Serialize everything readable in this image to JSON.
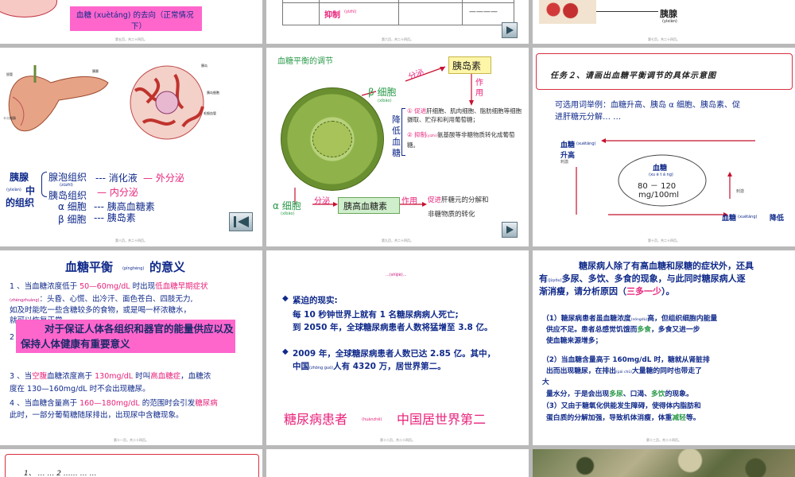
{
  "slides": {
    "s1": {
      "caption": "血糖 (xuètáng) 的去向（正常情况下）",
      "caption_l1": "血糖 (xuètáng) 的去向（正常情况",
      "caption_l2": "下）",
      "page": "第五页，共二十四页。"
    },
    "s2": {
      "row_label": "抑制",
      "row_pinyin": "(yìzhì)",
      "row_value": "————",
      "page": "第六页，共二十四页。"
    },
    "s3": {
      "label": "胰腺",
      "pinyin": "(yíxiàn)",
      "page": "第七页，共二十四页。"
    },
    "s4": {
      "title_main": "胰腺",
      "title_pinyin": "(yíxiàn)",
      "title_rest": "中",
      "title_l2": "的组织",
      "exo": "腺泡组织",
      "exo_pinyin": "(zūzhī)",
      "endo": "胰岛组织",
      "line1_a": "--- 消化液",
      "line1_b": "— 外分泌",
      "line2": "— 内分泌",
      "alpha": "α 细胞",
      "alpha_v": "--- 胰高血糖素",
      "beta": "β 细胞",
      "beta_v": "--- 胰岛素",
      "fig_labels": [
        "胆管",
        "胰腺",
        "十二指肠",
        "胰岛",
        "胰岛细胞",
        "毛细血管"
      ],
      "page": "第八页，共二十四页。"
    },
    "s5": {
      "title": "血糖平衡的调节",
      "beta_cell": "β 细胞",
      "beta_pinyin": "(xìbāo)",
      "secrete": "分泌",
      "insulin": "胰岛素",
      "action": "作用",
      "side_label": "降低血糖",
      "p1_head": "① 促进",
      "p1": "肝细胞、肌肉细胞、脂肪细胞等细胞摄取、贮存和利用葡萄糖；",
      "p2_head": "② 抑制",
      "p2_pinyin": "(yìzhì)",
      "p2": "氨基酸等非糖物质转化成葡萄糖。",
      "alpha_cell": "α 细胞",
      "alpha_pinyin": "(xìbāo)",
      "secrete2": "分泌",
      "glucagon": "胰高血糖素",
      "action2": "作用",
      "promote2_head": "促进",
      "promote2": "肝糖元的分解和",
      "promote2_l2": "非糖物质的转化",
      "page": "第九页，共二十四页。"
    },
    "s6": {
      "title": "任务２、请画出血糖平衡调节的具体示意图",
      "words_l1": "可选用词举例：血糖升高、胰岛 α 细胞、胰岛素、促",
      "words_l2": "进肝糖元分解… …",
      "rise_a": "血糖",
      "rise_pinyin": "(xuètáng)",
      "rise_b": "升高",
      "stim": "刺激",
      "center": "血糖",
      "center_pinyin": "(xu è t á ng)",
      "range": "80 － 120",
      "unit": "mg/100ml",
      "stim2": "刺激",
      "fall_a": "血糖",
      "fall_pinyin": "(xuètáng)",
      "fall_b": "降低",
      "page": "第十页，共二十四页。"
    },
    "s7": {
      "title": "血糖平衡",
      "title_pinyin": "(pínghéng)",
      "title_end": "的意义",
      "l1a": "1 、当血糖浓度低于 ",
      "l1b": "50—60mg/dL",
      "l1c": " 时出现",
      "l1d": "低血糖早期症状",
      "l1_pinyin": "(zhèngzhuàng)",
      "l1e": "：头昏、心慌、出冷汗、面色苍白、四肢无力,",
      "l2": "如及时能吃一些含糖较多的食物，或是喝一杯浓糖水，",
      "l3": "就可以恢复正常",
      "box": "对于保证人体各组织和器官的能量供应以及保持人体健康有重要意义",
      "n2": "2",
      "l4a": "3 、当",
      "l4b": "空腹",
      "l4c": "血糖浓度高于 ",
      "l4d": "130mg/dL",
      "l4e": " 时叫",
      "l4f": "高血糖症",
      "l4g": "，血糖浓",
      "l5": "度在 130—160mg/dL 时不会出现糖尿。",
      "l6a": "4 、当血糖含量高于 ",
      "l6b": "160—180mg/dL",
      "l6c": " 的范围时会引发",
      "l6d": "糖尿病",
      "l7": "此时，一部分葡萄糖随尿排出，出现尿中含糖现象。",
      "page": "第十一页，共二十四页。"
    },
    "s8": {
      "header": "...(shìjiè)...",
      "b1_title": "紧迫的现实:",
      "b1_l1": "每 10 秒钟世界上就有 1 名糖尿病病人死亡;",
      "b1_l2": "到 2050 年，全球糖尿病患者人数将猛增至 3.8 亿。",
      "b2_l1": "2009 年，全球糖尿病患者人数已达 2.85 亿。其中，",
      "b2_l2a": "中国",
      "b2_pinyin": "(zhōng guó)",
      "b2_l2b": "人有 4320 万，居世界第二。",
      "footer_a": "糖尿病患者",
      "footer_pinyin": "(huànzhě)",
      "footer_b": "中国居世界第二",
      "page": "第十二页，共二十四页。"
    },
    "s9": {
      "p_l1": "糖尿病人除了有高血糖和尿糖的症状外，还具",
      "p_l2a": "有",
      "p_pinyin": "(jùyǒu)",
      "p_l2b": "多尿、多饮、多食的现象，与此同时糖尿病人逐",
      "p_l3a": "渐消瘦，请分析原因（",
      "p_l3b": "三多一少",
      "p_l3c": "）。",
      "a1_l1a": "（1）糖尿病患者虽血糖浓度",
      "a1_pinyin": "(nóngdù)",
      "a1_l1b": "高，但组织细胞内能量",
      "a1_l2a": "供应不足。患者总感觉饥饿而",
      "a1_l2b": "多食",
      "a1_l2c": "，多食又进一步",
      "a1_l3": "使血糖来源增多；",
      "a2_l1": "（2）当血糖含量高于 160mg/dL 时，糖就从肾脏排",
      "a2_l2a": "出而出现糖尿，在排出",
      "a2_pinyin": "(pái chū)",
      "a2_l2b": "大量糖的同时也带走了",
      "a2_l3": "大",
      "a2_l4a": "量水分，于是会出现",
      "a2_l4b": "多尿",
      "a2_l4c": "、口渴、",
      "a2_l4d": "多饮",
      "a2_l4e": "的现象。",
      "a3_l1": "（3）又由于糖氧化供能发生障碍，使得体内脂肪和",
      "a3_l2a": "蛋白质的分解加强，导致机体消瘦，体重",
      "a3_l2b": "减轻",
      "a3_l2c": "等。",
      "page": "第十三页，共二十四页。"
    },
    "s10": {
      "partial": "1、 …  …  2 …… …  …"
    }
  }
}
